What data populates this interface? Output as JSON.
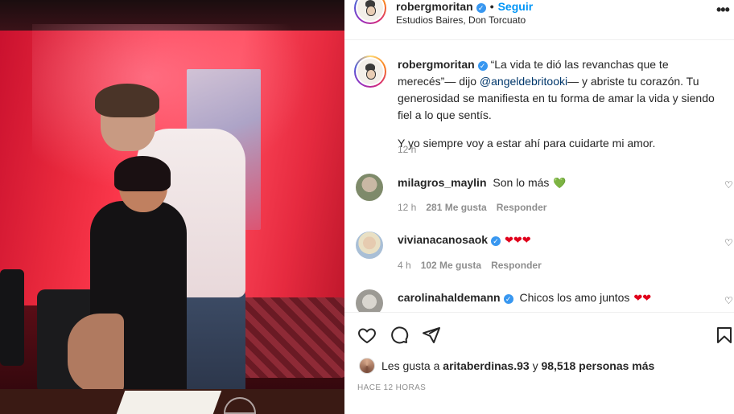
{
  "post": {
    "author": "robergmoritan",
    "follow_label": "Seguir",
    "location": "Estudios Baires, Don Torcuato"
  },
  "caption": {
    "author": "robergmoritan",
    "text_before_mention": "“La vida te dió las revanchas que te merecés”— dijo ",
    "mention": "@angeldebritooki",
    "text_after_mention": "— y abriste tu corazón. Tu generosidad se manifiesta en tu forma de amar la vida y siendo fiel a lo que sentís.",
    "second_paragraph": "Y yo siempre voy a estar ahí para cuidarte mi amor.",
    "time": "12 h"
  },
  "comments": [
    {
      "user": "milagros_maylin",
      "verified": false,
      "text": "Son lo más",
      "emoji": "💚",
      "time": "12 h",
      "likes": "281 Me gusta",
      "reply": "Responder"
    },
    {
      "user": "vivianacanosaok",
      "verified": true,
      "text": "",
      "emoji": "❤❤❤",
      "time": "4 h",
      "likes": "102 Me gusta",
      "reply": "Responder"
    },
    {
      "user": "carolinahaldemann",
      "verified": true,
      "text": "Chicos los amo juntos",
      "emoji": "❤❤",
      "time": "",
      "likes": "",
      "reply": ""
    }
  ],
  "likes": {
    "prefix": "Les gusta a",
    "user": "aritaberdinas.93",
    "middle": "y",
    "count": "98,518 personas más"
  },
  "timestamp": "HACE 12 HORAS",
  "icons": [
    "like-icon",
    "comment-icon",
    "share-icon",
    "save-icon",
    "more-icon",
    "verified-icon"
  ]
}
